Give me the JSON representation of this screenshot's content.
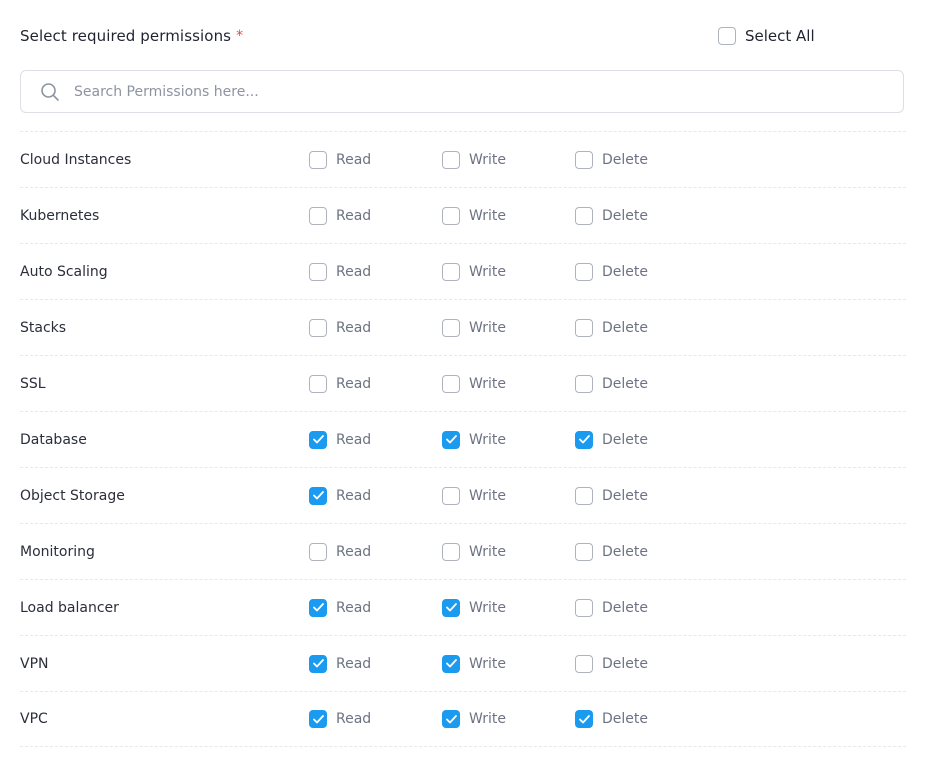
{
  "header": {
    "title": "Select required permissions",
    "required_marker": "*",
    "select_all_label": "Select All",
    "select_all_checked": false
  },
  "search": {
    "placeholder": "Search Permissions here...",
    "value": ""
  },
  "permission_labels": {
    "read": "Read",
    "write": "Write",
    "delete": "Delete"
  },
  "rows": [
    {
      "name": "Cloud Instances",
      "read": false,
      "write": false,
      "delete": false
    },
    {
      "name": "Kubernetes",
      "read": false,
      "write": false,
      "delete": false
    },
    {
      "name": "Auto Scaling",
      "read": false,
      "write": false,
      "delete": false
    },
    {
      "name": "Stacks",
      "read": false,
      "write": false,
      "delete": false
    },
    {
      "name": "SSL",
      "read": false,
      "write": false,
      "delete": false
    },
    {
      "name": "Database",
      "read": true,
      "write": true,
      "delete": true
    },
    {
      "name": "Object Storage",
      "read": true,
      "write": false,
      "delete": false
    },
    {
      "name": "Monitoring",
      "read": false,
      "write": false,
      "delete": false
    },
    {
      "name": "Load balancer",
      "read": true,
      "write": true,
      "delete": false
    },
    {
      "name": "VPN",
      "read": true,
      "write": true,
      "delete": false
    },
    {
      "name": "VPC",
      "read": true,
      "write": true,
      "delete": true
    }
  ],
  "colors": {
    "accent": "#1a9bf0",
    "required": "#e5484d"
  }
}
